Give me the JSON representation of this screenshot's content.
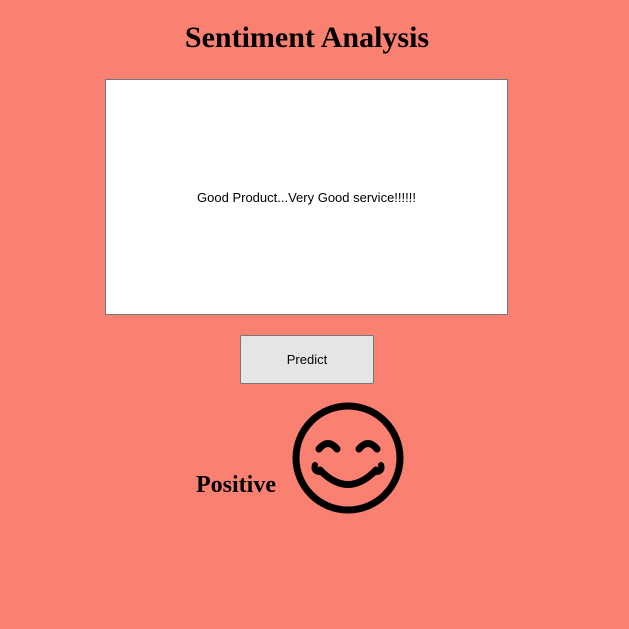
{
  "header": {
    "title": "Sentiment Analysis"
  },
  "review": {
    "text": "Good Product...Very Good service!!!!!!"
  },
  "actions": {
    "predict_label": "Predict"
  },
  "result": {
    "label": "Positive",
    "icon": "smiling-face-icon"
  },
  "colors": {
    "background": "#FA8072",
    "text": "#000000",
    "button_bg": "#E5E5E5",
    "input_bg": "#FFFFFF"
  }
}
